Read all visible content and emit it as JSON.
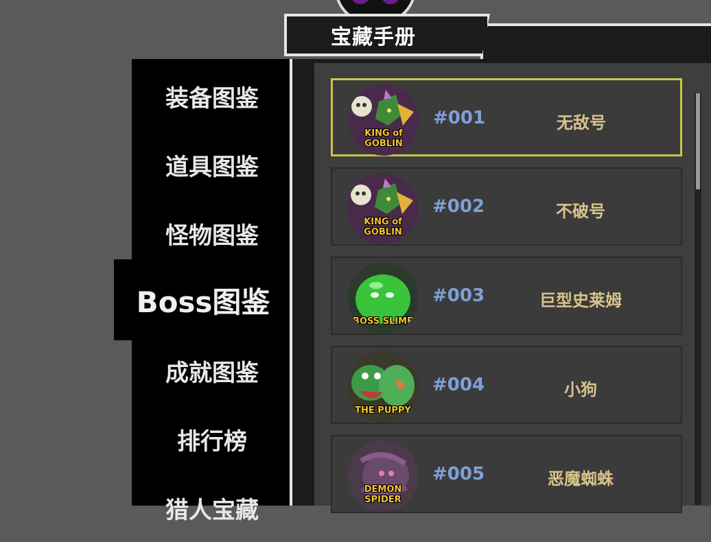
{
  "header": {
    "title": "宝藏手册",
    "emblem_icon": "demon-emblem-icon"
  },
  "sidebar": {
    "items": [
      {
        "label": "装备图鉴",
        "active": false
      },
      {
        "label": "道具图鉴",
        "active": false
      },
      {
        "label": "怪物图鉴",
        "active": false
      },
      {
        "label": "Boss图鉴",
        "active": true
      },
      {
        "label": "成就图鉴",
        "active": false
      },
      {
        "label": "排行榜",
        "active": false
      },
      {
        "label": "猎人宝藏",
        "active": false
      }
    ]
  },
  "boss_list": [
    {
      "number": "#001",
      "name": "无敌号",
      "avatar_label": "KING of GOBLIN",
      "avatar_icon": "goblin-king-portrait",
      "selected": true
    },
    {
      "number": "#002",
      "name": "不破号",
      "avatar_label": "KING of GOBLIN",
      "avatar_icon": "goblin-king-portrait",
      "selected": false
    },
    {
      "number": "#003",
      "name": "巨型史莱姆",
      "avatar_label": "BOSS SLIME",
      "avatar_icon": "boss-slime-portrait",
      "selected": false
    },
    {
      "number": "#004",
      "name": "小狗",
      "avatar_label": "THE PUPPY",
      "avatar_icon": "puppy-portrait",
      "selected": false
    },
    {
      "number": "#005",
      "name": "恶魔蜘蛛",
      "avatar_label": "DEMON SPIDER",
      "avatar_icon": "demon-spider-portrait",
      "selected": false
    }
  ],
  "colors": {
    "selected_border": "#c9c64a",
    "number": "#7ea0d8",
    "name": "#d8c38a"
  }
}
